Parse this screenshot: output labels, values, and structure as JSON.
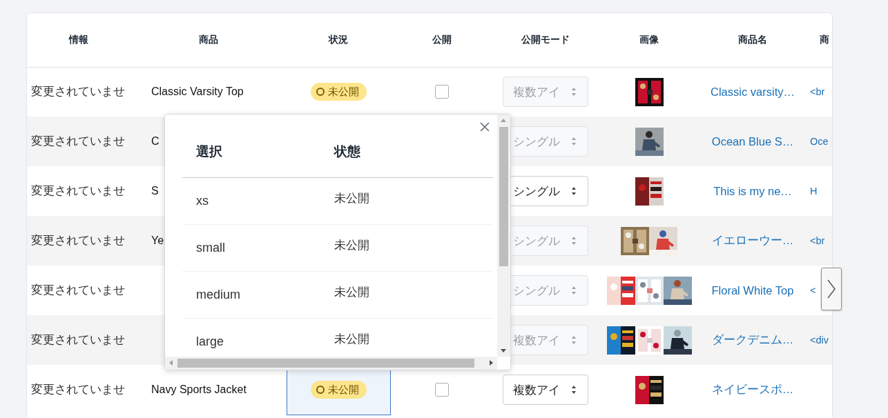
{
  "table": {
    "columns": [
      "情報",
      "商品",
      "状況",
      "公開",
      "公開モード",
      "画像",
      "商品名",
      "商"
    ],
    "rows": [
      {
        "info": "変更されていませ",
        "product": "Classic Varsity Top",
        "status": {
          "label": "未公開",
          "selected": false
        },
        "public": {
          "checked": false
        },
        "mode": {
          "label": "複数アイ",
          "disabled": true
        },
        "name": "Classic varsity…",
        "column_8": "<br"
      },
      {
        "info": "変更されていませ",
        "product": "C",
        "mode": {
          "label": "シングル",
          "disabled": true
        },
        "name": "Ocean Blue S…",
        "column_8": "Oce"
      },
      {
        "info": "変更されていませ",
        "product": "S",
        "mode": {
          "label": "シングル",
          "disabled": false
        },
        "name": "This is my ne…",
        "column_8": "H"
      },
      {
        "info": "変更されていませ",
        "product": "Ye",
        "mode": {
          "label": "シングル",
          "disabled": true
        },
        "name": "イエローウー…",
        "column_8": "<br"
      },
      {
        "info": "変更されていませ",
        "mode": {
          "label": "シングル",
          "disabled": true
        },
        "name": "Floral White Top",
        "column_8": "<"
      },
      {
        "info": "変更されていませ",
        "mode": {
          "label": "複数アイ",
          "disabled": true
        },
        "name": "ダークデニム…",
        "column_8": "<div"
      },
      {
        "info": "変更されていませ",
        "product": "Navy Sports Jacket",
        "status": {
          "label": "未公開",
          "selected": true
        },
        "public": {
          "checked": false
        },
        "mode": {
          "label": "複数アイ",
          "disabled": false
        },
        "name": "ネイビースポ…"
      }
    ]
  },
  "variant_popup": {
    "columns": [
      "選択",
      "状態"
    ],
    "rows": [
      {
        "option": "xs",
        "state": "未公開"
      },
      {
        "option": "small",
        "state": "未公開"
      },
      {
        "option": "medium",
        "state": "未公開"
      },
      {
        "option": "large",
        "state": "未公開"
      }
    ]
  }
}
